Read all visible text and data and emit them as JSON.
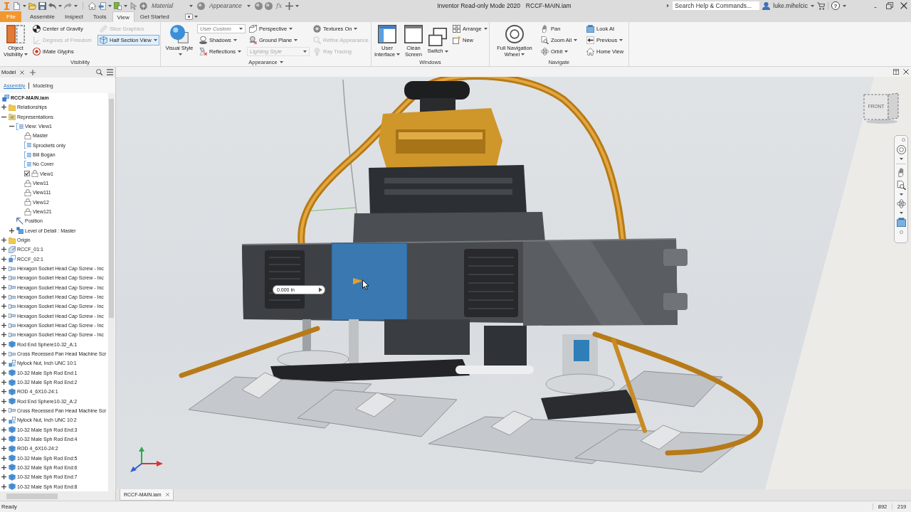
{
  "title_bar": {
    "quick_access": {
      "material": "Material",
      "appearance": "Appearance",
      "formula": "fx"
    },
    "title": "Inventor Read-only Mode 2020",
    "document": "RCCF-MAIN.iam",
    "search": {
      "placeholder": "Search Help & Commands..."
    },
    "user": "luke.mihelcic",
    "help": "?"
  },
  "ribbon_tabs": [
    {
      "label": "File",
      "kind": "application",
      "selected": false
    },
    {
      "label": "Assemble",
      "kind": "tab",
      "selected": false
    },
    {
      "label": "Inspect",
      "kind": "tab",
      "selected": false
    },
    {
      "label": "Tools",
      "kind": "tab",
      "selected": false
    },
    {
      "label": "View",
      "kind": "tab",
      "selected": true
    },
    {
      "label": "Get Started",
      "kind": "tab",
      "selected": false
    }
  ],
  "ribbon_panels": [
    {
      "label": "Visibility",
      "menu": false,
      "large_buttons": [
        {
          "label": "Object Visibility",
          "dropdown": true
        }
      ],
      "columns": [
        [
          {
            "label": "Center of Gravity",
            "kind": "button",
            "disabled": false,
            "dropdown": false,
            "active": false
          },
          {
            "label": "Degrees of Freedom",
            "kind": "button",
            "disabled": true,
            "dropdown": false,
            "active": false
          },
          {
            "label": "iMate Glyphs",
            "kind": "button",
            "disabled": false,
            "dropdown": false,
            "active": false
          }
        ],
        [
          {
            "label": "Slice Graphics",
            "kind": "button",
            "disabled": true,
            "dropdown": false,
            "active": false
          },
          {
            "label": "Half Section View",
            "kind": "button",
            "disabled": false,
            "dropdown": true,
            "active": true
          }
        ]
      ]
    },
    {
      "label": "Appearance",
      "menu": true,
      "large_buttons": [
        {
          "label": "Visual Style",
          "dropdown": true
        }
      ],
      "columns": [
        [
          {
            "label": "User Custom",
            "kind": "combo",
            "disabled": false,
            "dropdown": true,
            "active": false
          },
          {
            "label": "Shadows",
            "kind": "button",
            "disabled": false,
            "dropdown": true,
            "active": false
          },
          {
            "label": "Reflections",
            "kind": "button",
            "disabled": false,
            "dropdown": true,
            "active": false
          }
        ],
        [
          {
            "label": "Perspective",
            "kind": "button",
            "disabled": false,
            "dropdown": true,
            "active": false
          },
          {
            "label": "Ground Plane",
            "kind": "button",
            "disabled": false,
            "dropdown": true,
            "active": false
          },
          {
            "label": "Lighting Style",
            "kind": "combo",
            "disabled": true,
            "dropdown": true,
            "active": false
          }
        ],
        [
          {
            "label": "Textures On",
            "kind": "button",
            "disabled": false,
            "dropdown": true,
            "active": false
          },
          {
            "label": "Refine Appearance",
            "kind": "button",
            "disabled": true,
            "dropdown": false,
            "active": false
          },
          {
            "label": "Ray Tracing",
            "kind": "button",
            "disabled": true,
            "dropdown": false,
            "active": false
          }
        ]
      ]
    },
    {
      "label": "Windows",
      "menu": false,
      "large_buttons": [
        {
          "label": "User Interface",
          "dropdown": true
        },
        {
          "label": "Clean Screen",
          "dropdown": false
        },
        {
          "label": "Switch",
          "dropdown": true
        }
      ],
      "columns": [
        [
          {
            "label": "Arrange",
            "kind": "button",
            "disabled": false,
            "dropdown": true,
            "active": false
          },
          {
            "label": "New",
            "kind": "button",
            "disabled": false,
            "dropdown": false,
            "active": false
          }
        ]
      ]
    },
    {
      "label": "Navigate",
      "menu": false,
      "large_buttons": [
        {
          "label": "Full Navigation Wheel",
          "dropdown": true
        }
      ],
      "columns": [
        [
          {
            "label": "Pan",
            "kind": "button",
            "disabled": false,
            "dropdown": false,
            "active": false
          },
          {
            "label": "Zoom All",
            "kind": "button",
            "disabled": false,
            "dropdown": true,
            "active": false
          },
          {
            "label": "Orbit",
            "kind": "button",
            "disabled": false,
            "dropdown": true,
            "active": false
          }
        ],
        [
          {
            "label": "Look At",
            "kind": "button",
            "disabled": false,
            "dropdown": false,
            "active": false
          },
          {
            "label": "Previous",
            "kind": "button",
            "disabled": false,
            "dropdown": true,
            "active": false
          },
          {
            "label": "Home View",
            "kind": "button",
            "disabled": false,
            "dropdown": false,
            "active": false
          }
        ]
      ]
    }
  ],
  "model_browser": {
    "tab": "Model",
    "subtabs": [
      {
        "label": "Assembly",
        "selected": true
      },
      {
        "label": "Modeling",
        "selected": false
      }
    ],
    "tree": [
      {
        "label": "RCCF-MAIN.iam",
        "kind": "assembly",
        "children": [
          {
            "label": "Relationships",
            "kind": "folder",
            "expandable": true,
            "expanded": false
          },
          {
            "label": "Representations",
            "kind": "representations",
            "expandable": true,
            "expanded": true,
            "children": [
              {
                "label": "View: View1",
                "kind": "view",
                "expandable": true,
                "expanded": true,
                "children": [
                  {
                    "label": "Master",
                    "kind": "lock",
                    "expandable": false,
                    "active": false
                  },
                  {
                    "label": "Sprockets only",
                    "kind": "view",
                    "expandable": false,
                    "active": false
                  },
                  {
                    "label": "Bill Bogan",
                    "kind": "view",
                    "expandable": false,
                    "active": false
                  },
                  {
                    "label": "No Cover",
                    "kind": "view",
                    "expandable": false,
                    "active": false
                  },
                  {
                    "label": "View1",
                    "kind": "lock",
                    "expandable": false,
                    "active": true
                  },
                  {
                    "label": "View11",
                    "kind": "lock",
                    "expandable": false,
                    "active": false
                  },
                  {
                    "label": "View111",
                    "kind": "lock",
                    "expandable": false,
                    "active": false
                  },
                  {
                    "label": "View12",
                    "kind": "lock",
                    "expandable": false,
                    "active": false
                  },
                  {
                    "label": "View121",
                    "kind": "lock",
                    "expandable": false,
                    "active": false
                  }
                ]
              },
              {
                "label": "Position",
                "kind": "position",
                "expandable": false
              },
              {
                "label": "Level of Detail : Master",
                "kind": "lod",
                "expandable": true,
                "expanded": false
              }
            ]
          },
          {
            "label": "Origin",
            "kind": "folder",
            "expandable": true,
            "expanded": false
          },
          {
            "label": "RCCF_01:1",
            "kind": "sheet-part",
            "expandable": true,
            "expanded": false
          },
          {
            "label": "RCCF_02:1",
            "kind": "subassembly",
            "expandable": true,
            "expanded": false
          },
          {
            "label": "Hexagon Socket Head Cap Screw - Inc",
            "kind": "fastener",
            "expandable": true,
            "expanded": false
          },
          {
            "label": "Hexagon Socket Head Cap Screw - Inc",
            "kind": "fastener",
            "expandable": true,
            "expanded": false
          },
          {
            "label": "Hexagon Socket Head Cap Screw - Inc",
            "kind": "fastener",
            "expandable": true,
            "expanded": false
          },
          {
            "label": "Hexagon Socket Head Cap Screw - Inc",
            "kind": "fastener",
            "expandable": true,
            "expanded": false
          },
          {
            "label": "Hexagon Socket Head Cap Screw - Inc",
            "kind": "fastener",
            "expandable": true,
            "expanded": false
          },
          {
            "label": "Hexagon Socket Head Cap Screw - Inc",
            "kind": "fastener",
            "expandable": true,
            "expanded": false
          },
          {
            "label": "Hexagon Socket Head Cap Screw - Inc",
            "kind": "fastener",
            "expandable": true,
            "expanded": false
          },
          {
            "label": "Hexagon Socket Head Cap Screw - Inc",
            "kind": "fastener",
            "expandable": true,
            "expanded": false
          },
          {
            "label": "Rod End Sphere10-32_A:1",
            "kind": "part",
            "expandable": true,
            "expanded": false
          },
          {
            "label": "Cross Recessed Pan Head Machine Scr",
            "kind": "fastener",
            "expandable": true,
            "expanded": false
          },
          {
            "label": "Nylock Nut, Inch UNC 10:1",
            "kind": "nut",
            "expandable": true,
            "expanded": false
          },
          {
            "label": "10-32 Male Sph Rod End:1",
            "kind": "part",
            "expandable": true,
            "expanded": false
          },
          {
            "label": "10-32 Male Sph Rod End:2",
            "kind": "part",
            "expandable": true,
            "expanded": false
          },
          {
            "label": "ROD 4_6X10-24:1",
            "kind": "part",
            "expandable": true,
            "expanded": false
          },
          {
            "label": "Rod End Sphere10-32_A:2",
            "kind": "part",
            "expandable": true,
            "expanded": false
          },
          {
            "label": "Cross Recessed Pan Head Machine Scr",
            "kind": "fastener",
            "expandable": true,
            "expanded": false
          },
          {
            "label": "Nylock Nut, Inch UNC 10:2",
            "kind": "nut",
            "expandable": true,
            "expanded": false
          },
          {
            "label": "10-32 Male Sph Rod End:3",
            "kind": "part",
            "expandable": true,
            "expanded": false
          },
          {
            "label": "10-32 Male Sph Rod End:4",
            "kind": "part",
            "expandable": true,
            "expanded": false
          },
          {
            "label": "ROD 4_6X10-24:2",
            "kind": "part",
            "expandable": true,
            "expanded": false
          },
          {
            "label": "10-32 Male Sph Rod End:5",
            "kind": "part",
            "expandable": true,
            "expanded": false
          },
          {
            "label": "10-32 Male Sph Rod End:6",
            "kind": "part",
            "expandable": true,
            "expanded": false
          },
          {
            "label": "10-32 Male Sph Rod End:7",
            "kind": "part",
            "expandable": true,
            "expanded": false
          },
          {
            "label": "10-32 Male Sph Rod End:8",
            "kind": "part",
            "expandable": true,
            "expanded": false
          }
        ]
      }
    ]
  },
  "viewport": {
    "dimension_field": {
      "value": "0.000 in"
    },
    "view_cube": {
      "face": "FRONT"
    },
    "document_tabs": [
      {
        "label": "RCCF-MAIN.iam",
        "selected": true
      }
    ]
  },
  "status_bar": {
    "message": "Ready",
    "values": [
      "892",
      "219"
    ]
  }
}
